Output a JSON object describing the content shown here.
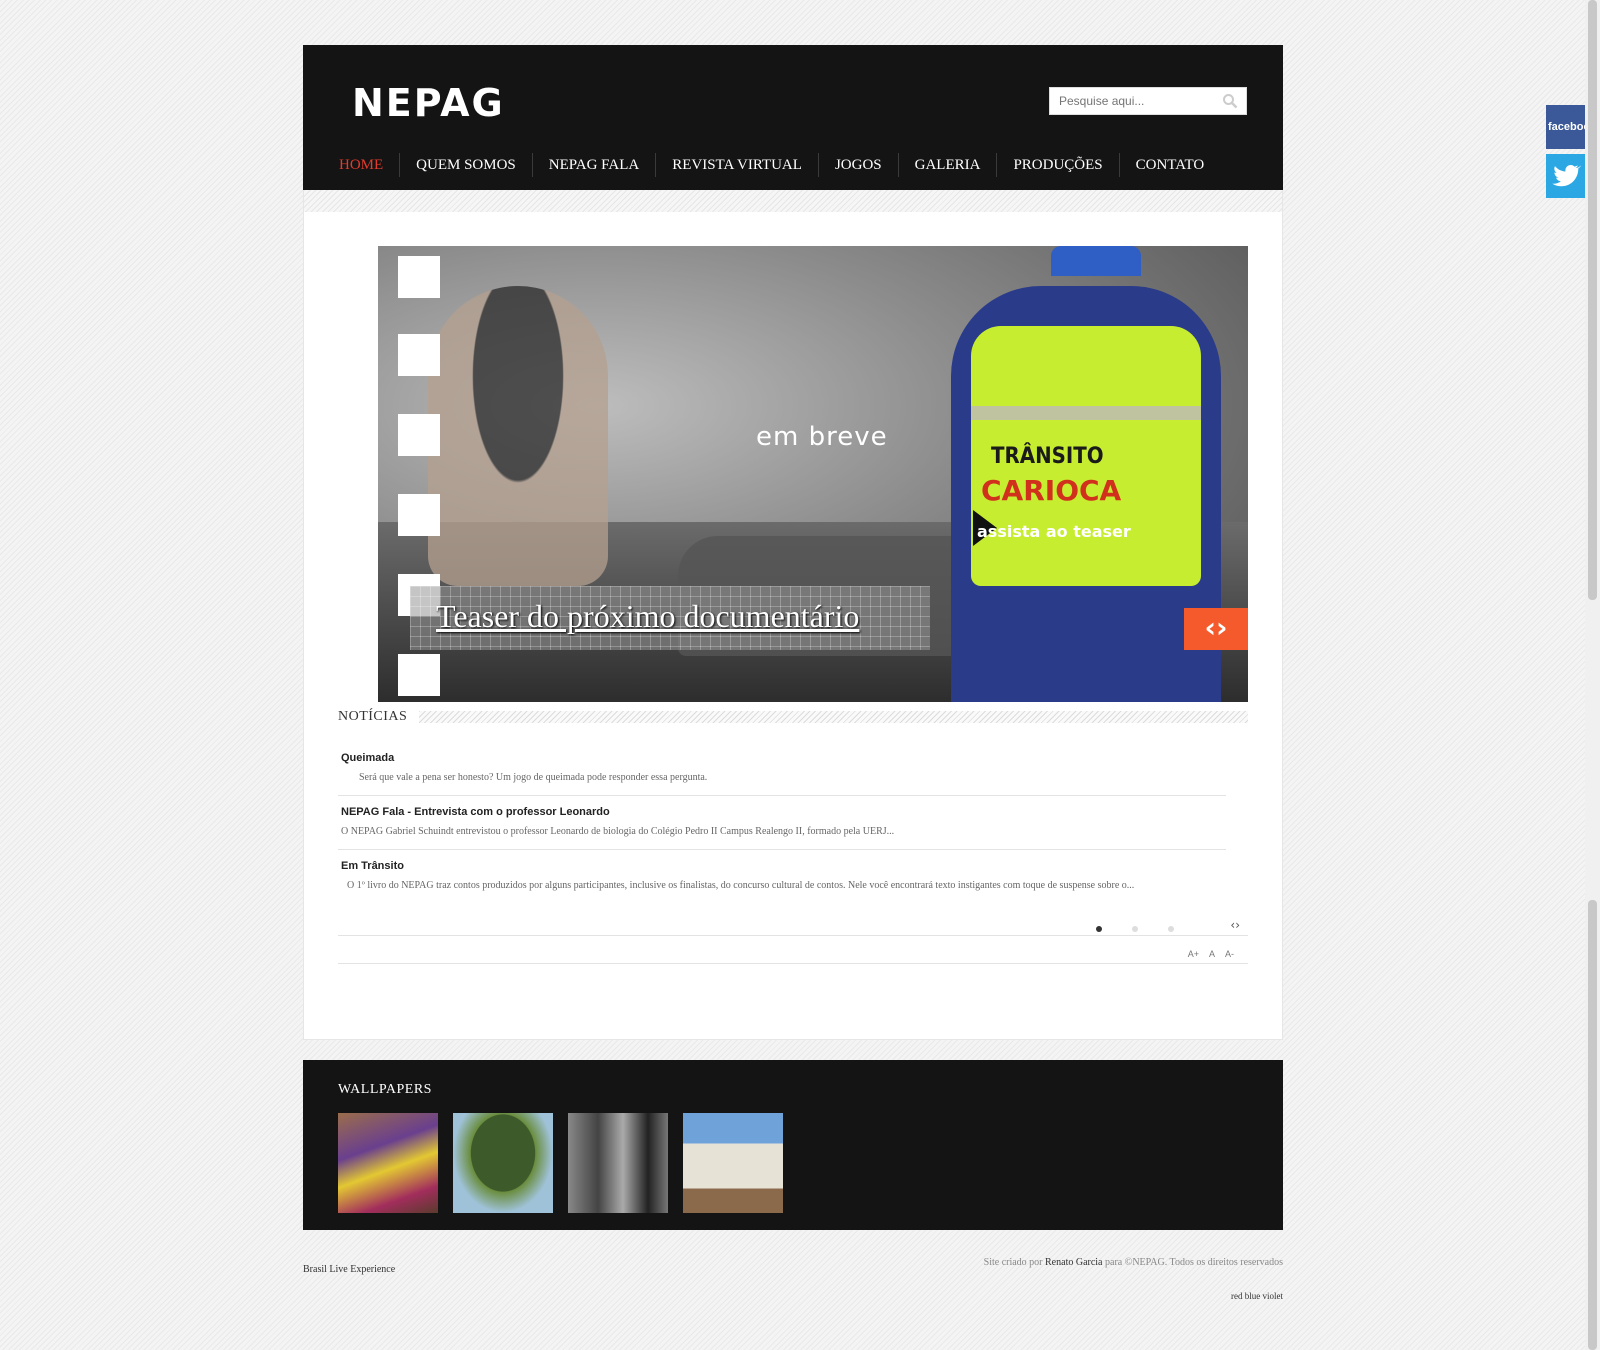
{
  "header": {
    "logo": "NEPAG",
    "search_placeholder": "Pesquise aqui..."
  },
  "nav": [
    {
      "label": "HOME"
    },
    {
      "label": "QUEM SOMOS"
    },
    {
      "label": "NEPAG FALA"
    },
    {
      "label": "REVISTA VIRTUAL"
    },
    {
      "label": "JOGOS"
    },
    {
      "label": "GALERIA"
    },
    {
      "label": "PRODUÇÕES"
    },
    {
      "label": "CONTATO"
    }
  ],
  "slider": {
    "overlay_text": "em breve",
    "vest_title": "TRÂNSITO",
    "vest_brand": "CARIOCA",
    "vest_cta": "assista ao teaser",
    "caption": "Teaser do próximo documentário"
  },
  "news": {
    "section_title": "NOTÍCIAS",
    "items": [
      {
        "title": "Queimada",
        "excerpt": "Será que vale a pena ser honesto? Um jogo de queimada pode responder essa pergunta."
      },
      {
        "title": "NEPAG Fala - Entrevista com o professor Leonardo",
        "excerpt": "O NEPAG Gabriel Schuindt entrevistou o professor Leonardo de biologia do Colégio Pedro II Campus Realengo II, formado pela UERJ..."
      },
      {
        "title": "Em Trânsito",
        "excerpt": "O 1º livro do NEPAG traz contos produzidos por alguns participantes, inclusive os finalistas, do concurso cultural de contos. Nele você encontrará texto instigantes com toque de suspense sobre o..."
      }
    ],
    "font_size_controls": [
      "A+",
      "A",
      "A-"
    ]
  },
  "wallpapers": {
    "title": "WALLPAPERS"
  },
  "footer": {
    "left": "Brasil Live Experience",
    "right_prefix": "Site criado por",
    "author": "Renato Garcia",
    "right_mid": "para",
    "right_suffix": "©NEPAG. Todos os direitos reservados",
    "themes": "red blue violet"
  },
  "social": {
    "facebook": "facebook"
  },
  "colors": {
    "header_bg": "#141414",
    "nav_active": "#e43b2c",
    "slider_arrow": "#f55a2c",
    "facebook": "#3b5998",
    "twitter": "#2ba8e4"
  }
}
